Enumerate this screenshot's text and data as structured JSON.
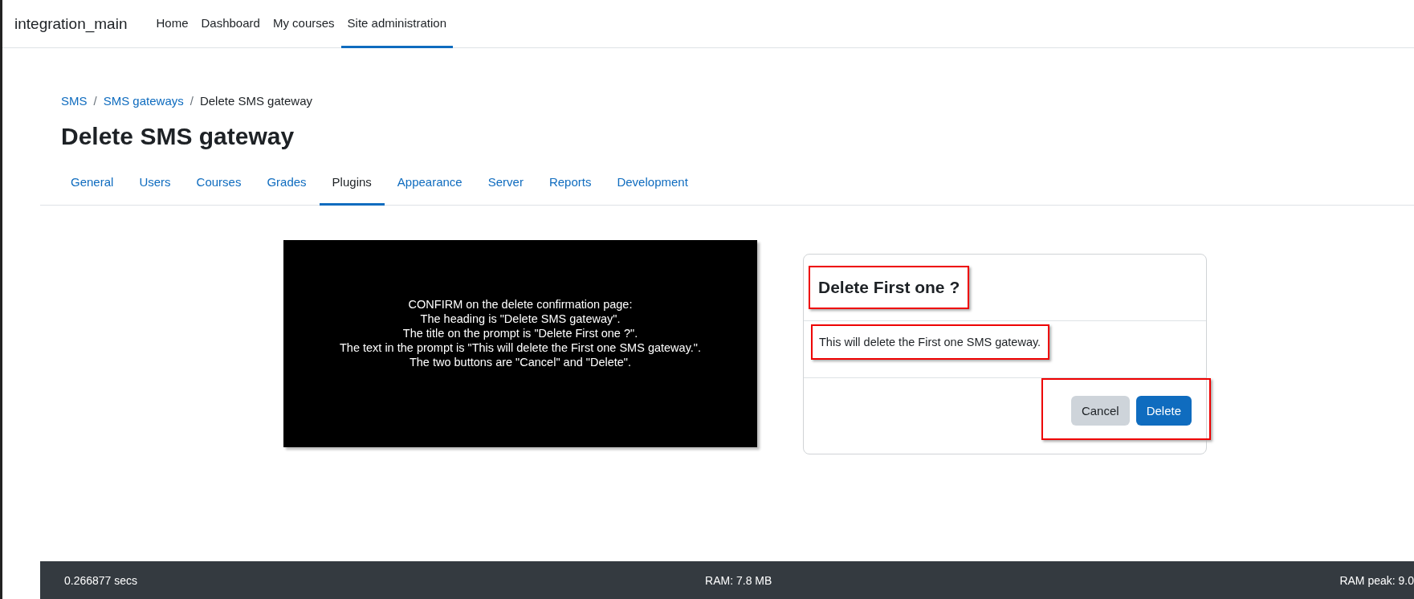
{
  "navbar": {
    "brand": "integration_main",
    "items": [
      {
        "label": "Home",
        "selected": false
      },
      {
        "label": "Dashboard",
        "selected": false
      },
      {
        "label": "My courses",
        "selected": false
      },
      {
        "label": "Site administration",
        "selected": true
      }
    ]
  },
  "breadcrumb": [
    {
      "label": "SMS",
      "link": true
    },
    {
      "separator": "/",
      "label": "SMS gateways",
      "link": true
    },
    {
      "separator": "/",
      "label": "Delete SMS gateway",
      "link": false
    }
  ],
  "heading": "Delete SMS gateway",
  "tabs": [
    {
      "label": "General",
      "selected": false
    },
    {
      "label": "Users",
      "selected": false
    },
    {
      "label": "Courses",
      "selected": false
    },
    {
      "label": "Grades",
      "selected": false
    },
    {
      "label": "Plugins",
      "selected": true
    },
    {
      "label": "Appearance",
      "selected": false
    },
    {
      "label": "Server",
      "selected": false
    },
    {
      "label": "Reports",
      "selected": false
    },
    {
      "label": "Development",
      "selected": false
    }
  ],
  "note": {
    "lines": [
      "CONFIRM on the delete confirmation page:",
      "The heading is \"Delete SMS gateway\".",
      "The title on the prompt is \"Delete First one ?\".",
      "The text in the prompt is \"This will delete the First one SMS gateway.\".",
      "The two buttons are \"Cancel\" and \"Delete\"."
    ]
  },
  "dialog": {
    "title": "Delete First one ?",
    "title_highlighted": true,
    "message": "This will delete the First one SMS gateway.",
    "message_highlighted": true,
    "buttons_highlighted": true,
    "buttons": [
      {
        "label": "Cancel",
        "kind": "secondary"
      },
      {
        "label": "Delete",
        "kind": "primary"
      }
    ]
  },
  "footer": {
    "time": "0.266877 secs",
    "ram": "RAM: 7.8 MB",
    "ram_peak": "RAM peak: 9.0"
  }
}
